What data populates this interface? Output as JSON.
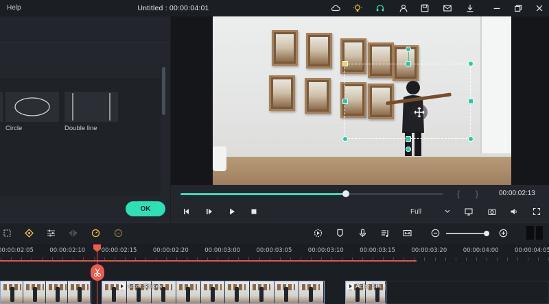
{
  "titlebar": {
    "menu_help": "Help",
    "title": "Untitled : 00:00:04:01",
    "icons": [
      "cloud-icon",
      "bulb-icon",
      "headset-icon",
      "user-icon",
      "save-icon",
      "mail-icon",
      "download-icon",
      "minimize-icon",
      "restore-icon",
      "close-icon"
    ]
  },
  "left_panel": {
    "tiles": [
      {
        "label": "Circle"
      },
      {
        "label": "Double line"
      }
    ],
    "ok_label": "OK",
    "accent_color": "#2ee0b8"
  },
  "preview": {
    "time": "00:00:02:13",
    "brace_open": "{",
    "brace_close": "}",
    "progress": 0.63,
    "zoom_select": "Full"
  },
  "timeline": {
    "ruler_labels": [
      "00:00:02:05",
      "00:00:02:10",
      "00:00:02:15",
      "00:00:02:20",
      "00:00:03:00",
      "00:00:03:05",
      "00:00:03:10",
      "00:00:03:15",
      "00:00:03:20",
      "00:00:04:00",
      "00:00:04:05"
    ],
    "clips": [
      {
        "label": ""
      },
      {
        "label": "Actor Strikes"
      },
      {
        "label": "Actor Stri..."
      }
    ],
    "playhead_color": "#f25a4f"
  }
}
